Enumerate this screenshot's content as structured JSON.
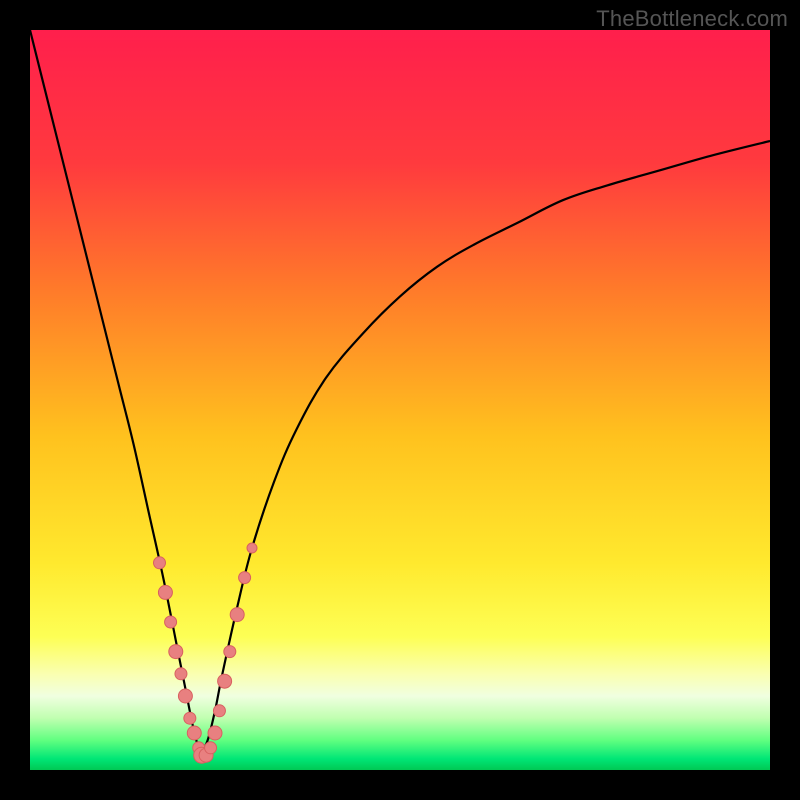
{
  "watermark": "TheBottleneck.com",
  "colors": {
    "gradient_stops": [
      {
        "pos": 0.0,
        "color": "#ff1f4c"
      },
      {
        "pos": 0.18,
        "color": "#ff3a3e"
      },
      {
        "pos": 0.35,
        "color": "#ff7a2a"
      },
      {
        "pos": 0.55,
        "color": "#ffc21e"
      },
      {
        "pos": 0.72,
        "color": "#ffe92e"
      },
      {
        "pos": 0.82,
        "color": "#fdff55"
      },
      {
        "pos": 0.87,
        "color": "#faffb0"
      },
      {
        "pos": 0.9,
        "color": "#f0ffe0"
      },
      {
        "pos": 0.93,
        "color": "#c0ffb0"
      },
      {
        "pos": 0.96,
        "color": "#60ff80"
      },
      {
        "pos": 0.985,
        "color": "#00e676"
      },
      {
        "pos": 1.0,
        "color": "#00c853"
      }
    ],
    "curve": "#000000",
    "dot_fill": "#e88080",
    "dot_stroke": "#d86060",
    "frame": "#000000"
  },
  "chart_data": {
    "type": "line",
    "title": "",
    "xlabel": "",
    "ylabel": "",
    "xlim": [
      0,
      100
    ],
    "ylim": [
      0,
      100
    ],
    "series": [
      {
        "name": "left-branch",
        "x": [
          0,
          2,
          4,
          6,
          8,
          10,
          12,
          14,
          16,
          18,
          20,
          21,
          22,
          23
        ],
        "y": [
          100,
          92,
          84,
          76,
          68,
          60,
          52,
          44,
          35,
          26,
          16,
          11,
          6,
          2
        ]
      },
      {
        "name": "right-branch",
        "x": [
          23,
          24,
          25,
          26,
          28,
          30,
          33,
          36,
          40,
          45,
          50,
          55,
          60,
          66,
          72,
          78,
          85,
          92,
          100
        ],
        "y": [
          2,
          4,
          8,
          13,
          22,
          30,
          39,
          46,
          53,
          59,
          64,
          68,
          71,
          74,
          77,
          79,
          81,
          83,
          85
        ]
      }
    ],
    "scatter": {
      "name": "sample-points",
      "points": [
        {
          "x": 17.5,
          "y": 28,
          "r": 6
        },
        {
          "x": 18.3,
          "y": 24,
          "r": 7
        },
        {
          "x": 19.0,
          "y": 20,
          "r": 6
        },
        {
          "x": 19.7,
          "y": 16,
          "r": 7
        },
        {
          "x": 20.4,
          "y": 13,
          "r": 6
        },
        {
          "x": 21.0,
          "y": 10,
          "r": 7
        },
        {
          "x": 21.6,
          "y": 7,
          "r": 6
        },
        {
          "x": 22.2,
          "y": 5,
          "r": 7
        },
        {
          "x": 22.8,
          "y": 3,
          "r": 6
        },
        {
          "x": 23.2,
          "y": 2,
          "r": 8
        },
        {
          "x": 23.8,
          "y": 2,
          "r": 7
        },
        {
          "x": 24.4,
          "y": 3,
          "r": 6
        },
        {
          "x": 25.0,
          "y": 5,
          "r": 7
        },
        {
          "x": 25.6,
          "y": 8,
          "r": 6
        },
        {
          "x": 26.3,
          "y": 12,
          "r": 7
        },
        {
          "x": 27.0,
          "y": 16,
          "r": 6
        },
        {
          "x": 28.0,
          "y": 21,
          "r": 7
        },
        {
          "x": 29.0,
          "y": 26,
          "r": 6
        },
        {
          "x": 30.0,
          "y": 30,
          "r": 5
        }
      ]
    }
  }
}
